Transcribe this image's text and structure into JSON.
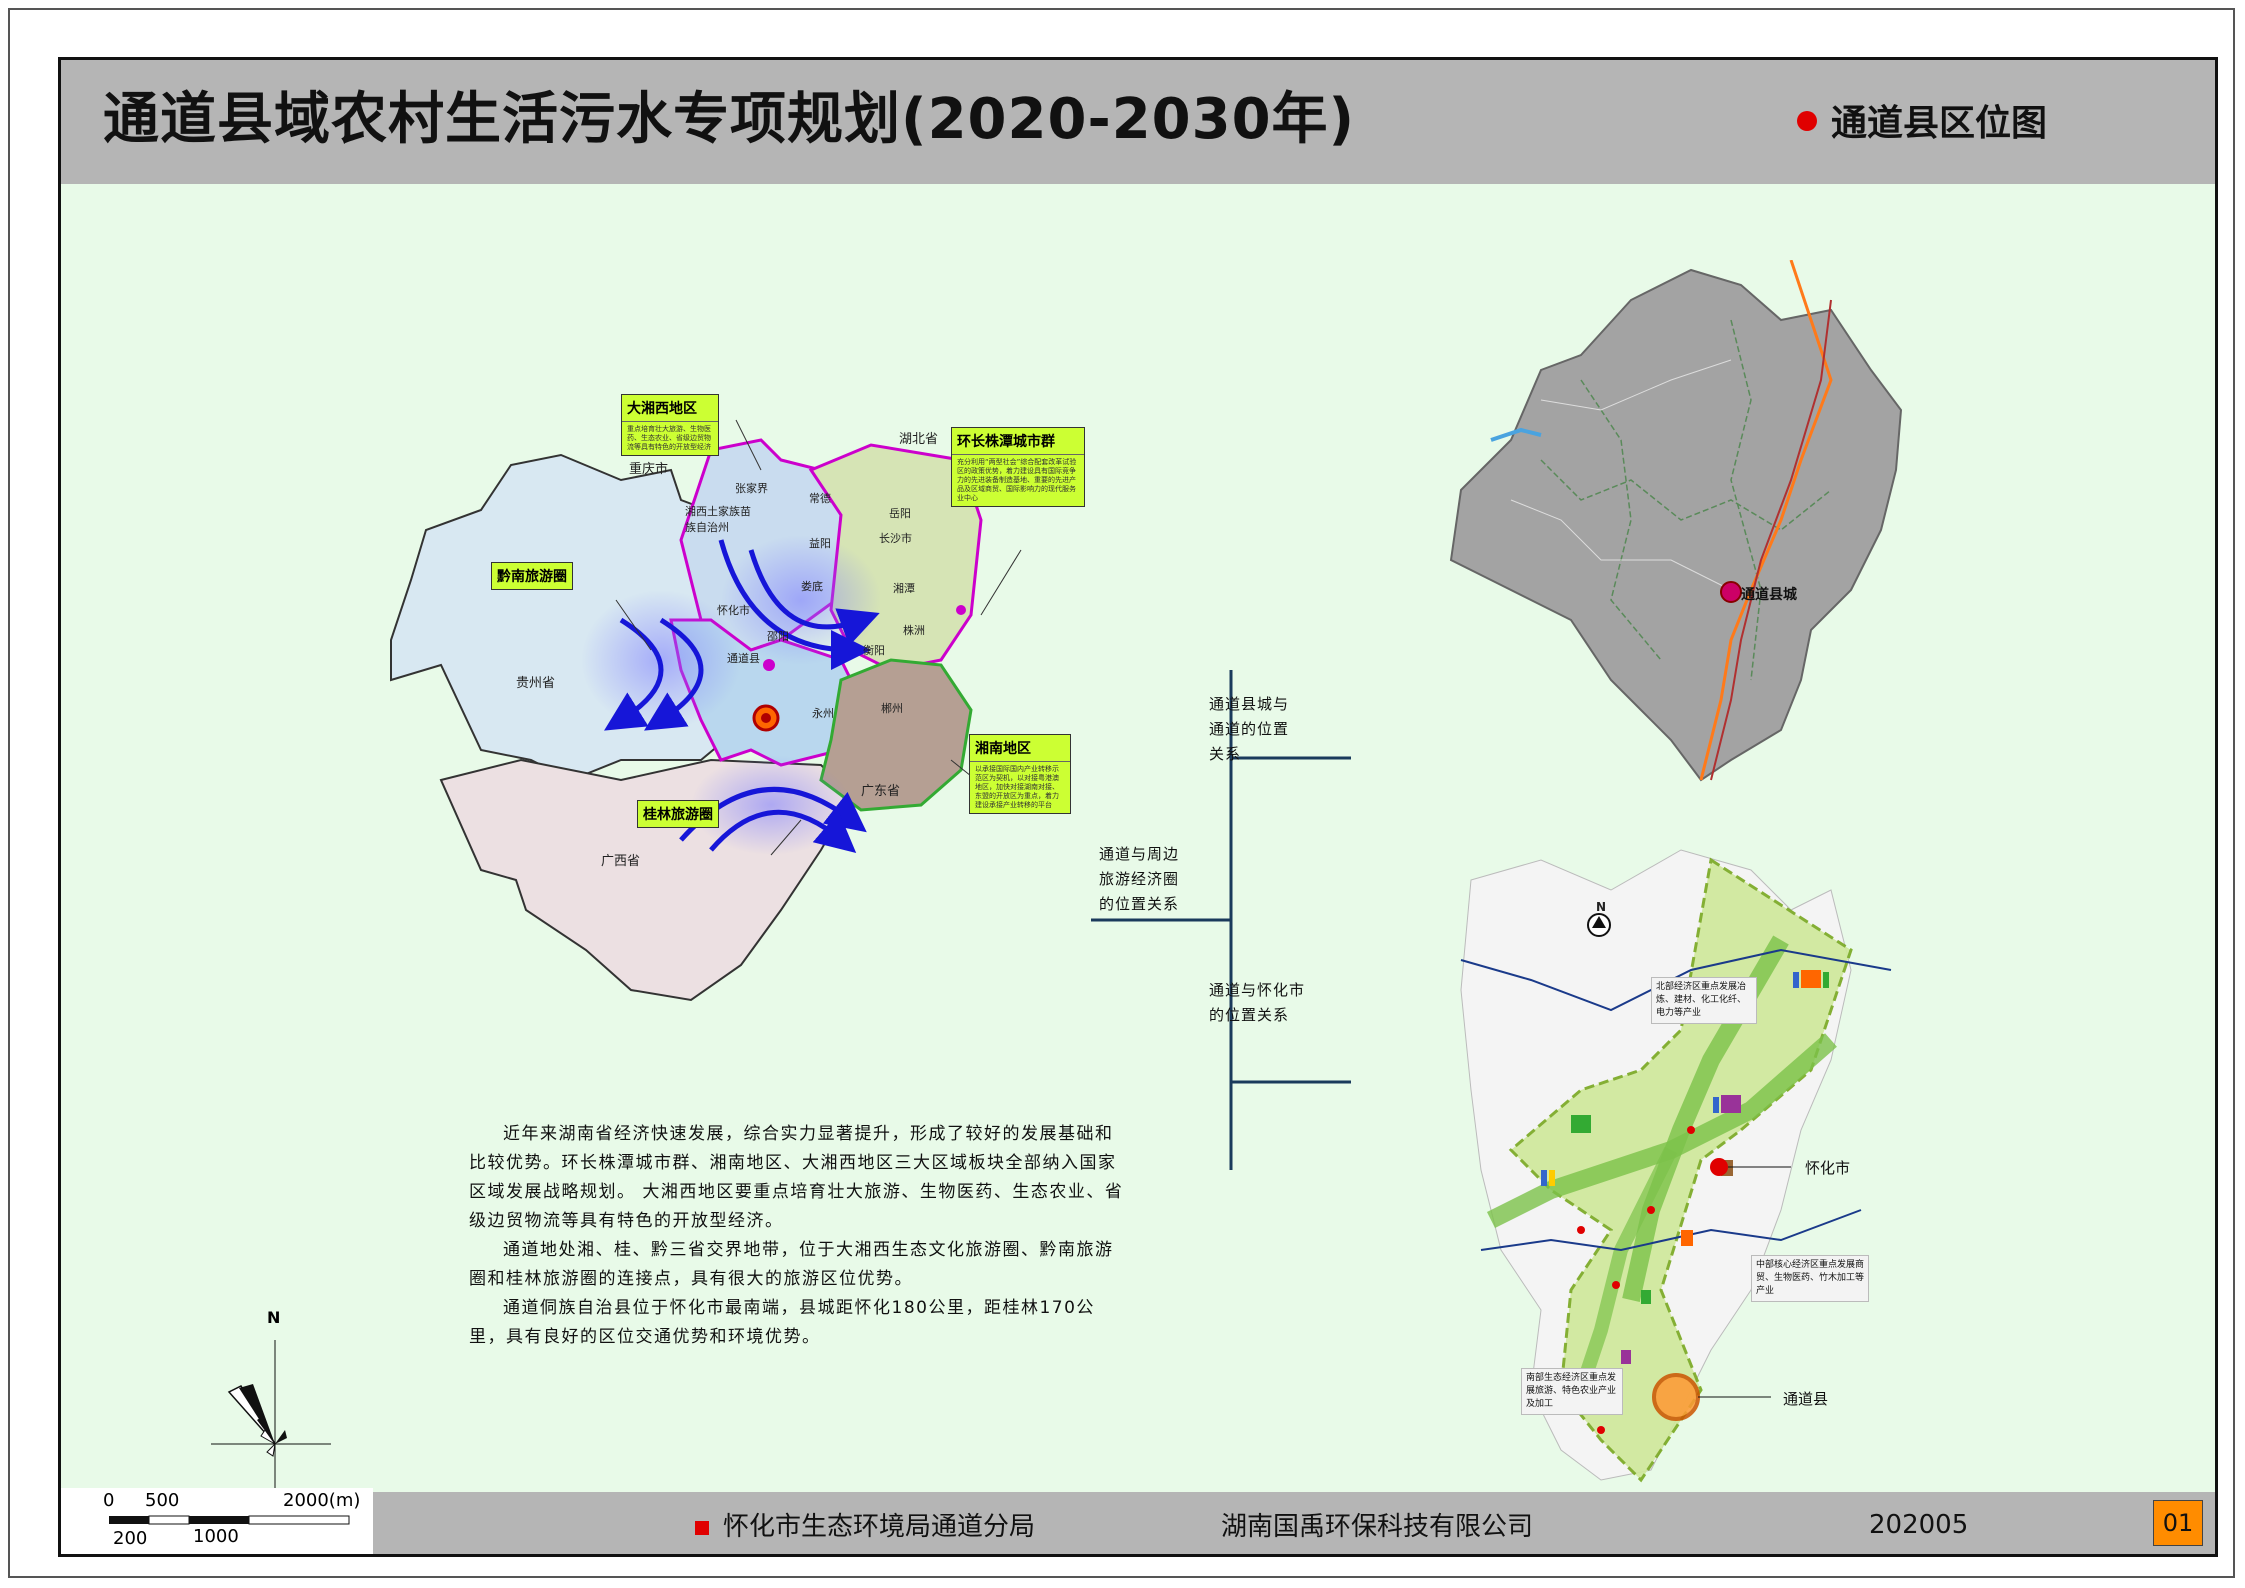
{
  "header": {
    "title": "通道县域农村生活污水专项规划(2020-2030年)",
    "section_title": "通道县区位图"
  },
  "regional_map": {
    "provinces": {
      "hubei": "湖北省",
      "chongqing": "重庆市",
      "guizhou": "贵州省",
      "guangxi": "广西省",
      "guangdong": "广东省"
    },
    "cities": {
      "zhangjiajie": "张家界",
      "xiangxi": "湘西土家族苗族自治州",
      "changde": "常德",
      "yueyang": "岳阳",
      "yiyang": "益阳",
      "changsha": "长沙市",
      "loudi": "娄底",
      "xiangtan": "湘潭",
      "zhuzhou": "株洲",
      "huaihua": "怀化市",
      "shaoyang": "邵阳",
      "tongdao": "通道县",
      "hengyang": "衡阳",
      "yongzhou": "永州",
      "chenzhou": "郴州"
    },
    "callouts": {
      "xiangxi_title": "大湘西地区",
      "xiangxi_body": "重点培育壮大旅游、生物医药、生态农业、省级边贸物流等具有特色的开放型经济",
      "cz_title": "环长株潭城市群",
      "cz_body": "充分利用“两型社会”综合配套改革试验区的政策优势，着力建设具有国际竞争力的先进装备制造基地、重要的先进产品及区域商贸、国际影响力的现代服务业中心",
      "xiangnan_title": "湘南地区",
      "xiangnan_body": "以承接国际国内产业转移示范区为契机，以对接粤港澳地区，加快对接湖南对接、东盟的开放区为重点，着力建设承接产业转移的平台",
      "qiannan_tag": "黔南旅游圈",
      "guilin_tag": "桂林旅游圈"
    }
  },
  "relation_tree": {
    "root": "通道与周边旅游经济圈的位置关系",
    "branch1": "通道县城与通道的位置关系",
    "branch2": "通道与怀化市的位置关系"
  },
  "county_map": {
    "county_seat": "通道县城"
  },
  "huaihua_map": {
    "north": "N",
    "huaihua": "怀化市",
    "tongdao": "通道县",
    "note_north": "北部经济区重点发展冶炼、建材、化工化纤、电力等产业",
    "note_central": "中部核心经济区重点发展商贸、生物医药、竹木加工等产业",
    "note_south": "南部生态经济区重点发展旅游、特色农业产业及加工"
  },
  "description": [
    "近年来湖南省经济快速发展，综合实力显著提升，形成了较好的发展基础和比较优势。环长株潭城市群、湘南地区、大湘西地区三大区域板块全部纳入国家区域发展战略规划。 大湘西地区要重点培育壮大旅游、生物医药、生态农业、省级边贸物流等具有特色的开放型经济。",
    "通道地处湘、桂、黔三省交界地带，位于大湘西生态文化旅游圈、黔南旅游圈和桂林旅游圈的连接点，具有很大的旅游区位优势。",
    "通道侗族自治县位于怀化市最南端，县城距怀化180公里，距桂林170公里，具有良好的区位交通优势和环境优势。"
  ],
  "compass": {
    "north": "N"
  },
  "scale_bar": {
    "top_labels": [
      "0",
      "500",
      "2000(m)"
    ],
    "bottom_labels": [
      "200",
      "1000"
    ]
  },
  "footer": {
    "authority": "怀化市生态环境局通道分局",
    "company": "湖南国禹环保科技有限公司",
    "date": "202005",
    "page": "01"
  },
  "colors": {
    "background": "#e8fae8",
    "titlebar": "#b5b5b5",
    "accent_red": "#e00000",
    "callout": "#ccff33",
    "page_box": "#ff8c00"
  }
}
